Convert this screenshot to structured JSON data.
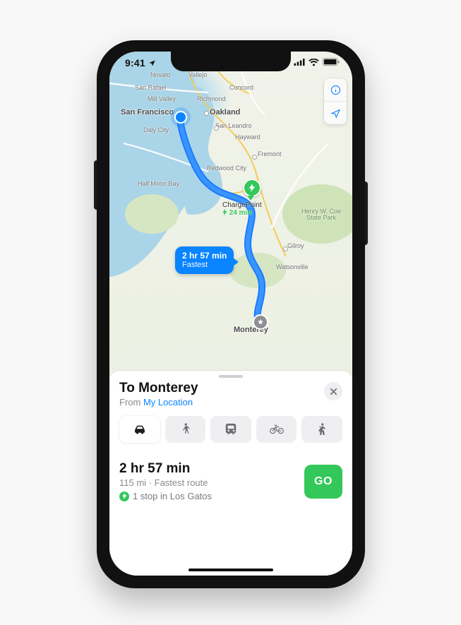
{
  "status_bar": {
    "time": "9:41"
  },
  "map": {
    "origin_label": "San Francisco",
    "dest_label": "Monterey",
    "places": {
      "novato": "Novato",
      "vallejo": "Vallejo",
      "san_rafael": "San Rafael",
      "concord": "Concord",
      "mill_valley": "Mill Valley",
      "richmond": "Richmond",
      "san_francisco": "San Francisco",
      "oakland": "Oakland",
      "daly_city": "Daly City",
      "san_leandro": "San Leandro",
      "hayward": "Hayward",
      "fremont": "Fremont",
      "redwood_city": "Redwood City",
      "half_moon_bay": "Half Moon Bay",
      "gilroy": "Gilroy",
      "watsonville": "Watsonville",
      "monterey": "Monterey"
    },
    "park_label": "Henry W. Coe\nState Park",
    "charger": {
      "name": "ChargePoint",
      "time": "24 min"
    },
    "callout": {
      "time": "2 hr 57 min",
      "note": "Fastest"
    }
  },
  "sheet": {
    "title": "To Monterey",
    "from_label": "From",
    "from_link": "My Location",
    "modes": {
      "drive": "drive",
      "walk": "walk",
      "transit": "transit",
      "bike": "bike",
      "rideshare": "rideshare"
    },
    "result": {
      "time": "2 hr 57 min",
      "distance": "115 mi",
      "note": "Fastest route",
      "stop_text": "1 stop in Los Gatos"
    },
    "go_label": "GO"
  }
}
